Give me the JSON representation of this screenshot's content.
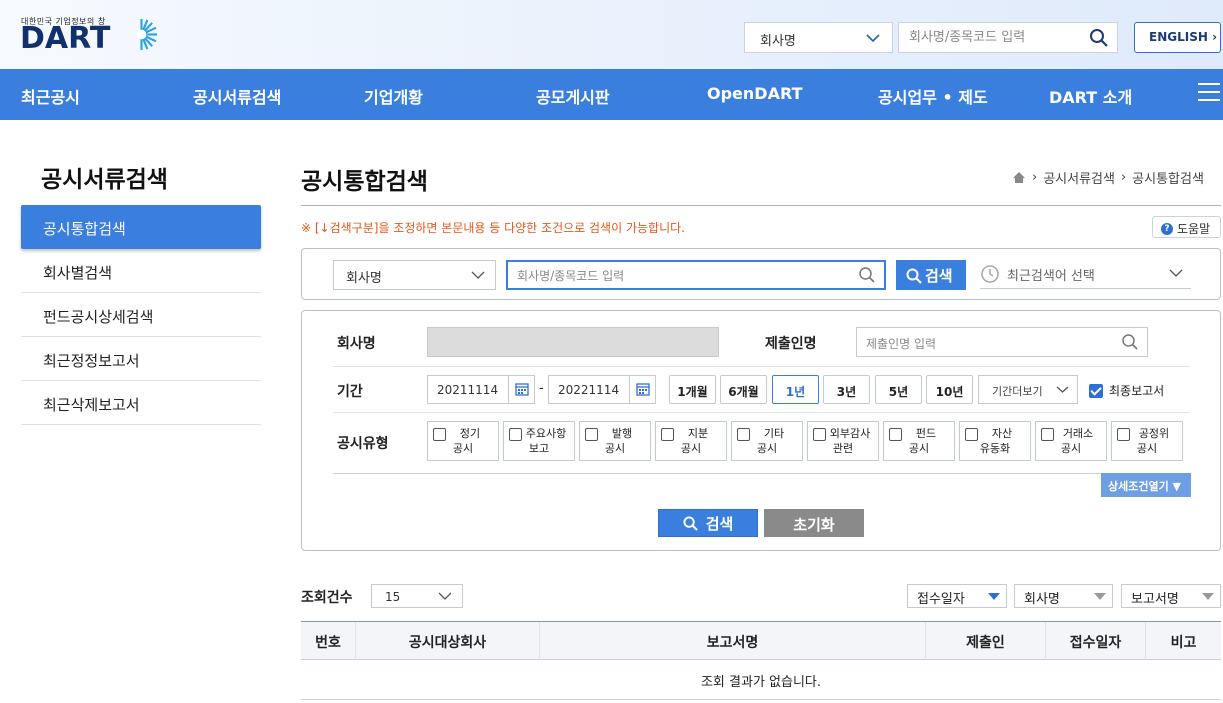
{
  "header": {
    "logo_tagline": "대한민국 기업정보의 창",
    "logo_text": "DART",
    "search_type": "회사명",
    "search_placeholder": "회사명/종목코드 입력",
    "english_label": "ENGLISH"
  },
  "nav": {
    "items": [
      "최근공시",
      "공시서류검색",
      "기업개황",
      "공모게시판",
      "OpenDART",
      "공시업무 • 제도",
      "DART 소개"
    ]
  },
  "sidebar": {
    "title": "공시서류검색",
    "items": [
      "공시통합검색",
      "회사별검색",
      "펀드공시상세검색",
      "최근정정보고서",
      "최근삭제보고서"
    ],
    "active_index": 0
  },
  "main": {
    "title": "공시통합검색",
    "breadcrumb": [
      "공시서류검색",
      "공시통합검색"
    ],
    "notice": "※ [↓검색구분]을 조정하면 본문내용 등 다양한 조건으로 검색이 가능합니다.",
    "help_label": "도움말"
  },
  "quick_search": {
    "type": "회사명",
    "placeholder": "회사명/종목코드 입력",
    "button": "검색",
    "recent_placeholder": "최근검색어 선택"
  },
  "filters": {
    "company_label": "회사명",
    "submitter_label": "제출인명",
    "submitter_placeholder": "제출인명 입력",
    "period_label": "기간",
    "start_date": "20211114",
    "end_date": "20221114",
    "dash": "-",
    "period_buttons": [
      "1개월",
      "6개월",
      "1년",
      "3년",
      "5년",
      "10년"
    ],
    "period_active": "1년",
    "more_period": "기간더보기",
    "final_report_label": "최종보고서",
    "final_report_checked": true,
    "type_label": "공시유형",
    "types": [
      {
        "l1": "정기",
        "l2": "공시"
      },
      {
        "l1": "주요사항",
        "l2": "보고"
      },
      {
        "l1": "발행",
        "l2": "공시"
      },
      {
        "l1": "지분",
        "l2": "공시"
      },
      {
        "l1": "기타",
        "l2": "공시"
      },
      {
        "l1": "외부감사",
        "l2": "관련"
      },
      {
        "l1": "펀드",
        "l2": "공시"
      },
      {
        "l1": "자산",
        "l2": "유동화"
      },
      {
        "l1": "거래소",
        "l2": "공시"
      },
      {
        "l1": "공정위",
        "l2": "공시"
      }
    ],
    "detail_toggle": "상세조건열기 ▼",
    "search_button": "검색",
    "reset_button": "초기화"
  },
  "results": {
    "count_label": "조회건수",
    "count_value": "15",
    "sort_options": [
      "접수일자",
      "회사명",
      "보고서명"
    ],
    "columns": [
      "번호",
      "공시대상회사",
      "보고서명",
      "제출인",
      "접수일자",
      "비고"
    ],
    "empty_message": "조회 결과가 없습니다."
  },
  "colors": {
    "primary": "#3a7fde",
    "notice": "#e5581d",
    "logo": "#12306b"
  }
}
